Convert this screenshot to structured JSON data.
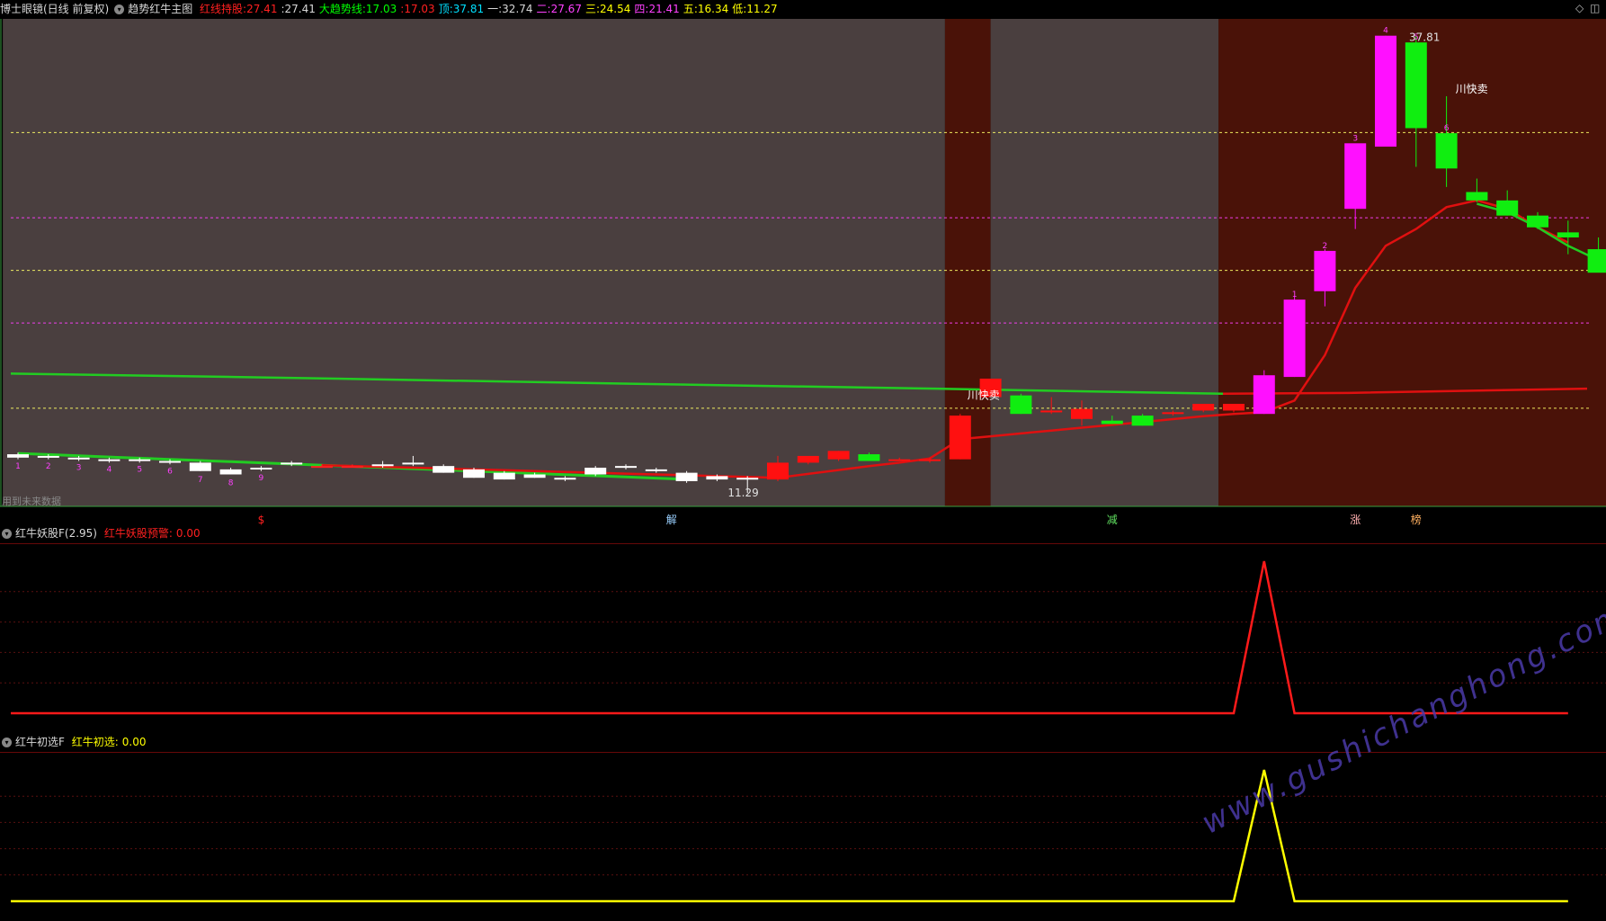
{
  "header": {
    "app_title": "博士眼镜(日线 前复权)",
    "main_indicator": "趋势红牛主图",
    "fields": [
      {
        "label": "红线持股",
        "value": "27.41",
        "color": "#ff2020"
      },
      {
        "label": "",
        "value": "27.41",
        "color": "#d8d8d8"
      },
      {
        "label": "大趋势线",
        "value": "17.03",
        "color": "#00ff00"
      },
      {
        "label": "",
        "value": "17.03",
        "color": "#ff2020"
      },
      {
        "label": "顶",
        "value": "37.81",
        "color": "#00e0ff"
      },
      {
        "label": "一",
        "value": "32.74",
        "color": "#d8d8d8"
      },
      {
        "label": "二",
        "value": "27.67",
        "color": "#ff40ff"
      },
      {
        "label": "三",
        "value": "24.54",
        "color": "#ffff00"
      },
      {
        "label": "四",
        "value": "21.41",
        "color": "#ff40ff"
      },
      {
        "label": "五",
        "value": "16.34",
        "color": "#ffff00"
      },
      {
        "label": "低",
        "value": "11.27",
        "color": "#ffff00"
      }
    ],
    "window_controls": [
      "◇",
      "◫"
    ]
  },
  "chart_data": [
    {
      "type": "candlestick",
      "title": "趋势红牛主图",
      "ylim": [
        10.5,
        39.5
      ],
      "x": [
        1,
        2,
        3,
        4,
        5,
        6,
        7,
        8,
        9,
        10,
        11,
        12,
        13,
        14,
        15,
        16,
        17,
        18,
        19,
        20,
        21,
        22,
        23,
        24,
        25,
        26,
        27,
        28,
        29,
        30,
        31,
        32,
        33,
        34,
        35,
        36,
        37,
        38,
        39,
        40,
        41,
        42,
        43,
        44,
        45,
        46,
        47,
        48,
        49,
        50,
        51,
        52
      ],
      "ohlc": [
        [
          13.6,
          13.7,
          13.3,
          13.4
        ],
        [
          13.5,
          13.6,
          13.3,
          13.4
        ],
        [
          13.4,
          13.5,
          13.2,
          13.3
        ],
        [
          13.3,
          13.4,
          13.1,
          13.2
        ],
        [
          13.3,
          13.4,
          13.1,
          13.2
        ],
        [
          13.2,
          13.3,
          13.0,
          13.1
        ],
        [
          13.1,
          13.2,
          12.6,
          12.6
        ],
        [
          12.7,
          12.8,
          12.4,
          12.4
        ],
        [
          12.8,
          12.9,
          12.6,
          12.7
        ],
        [
          13.1,
          13.2,
          12.9,
          13.0
        ],
        [
          12.9,
          13.0,
          12.8,
          12.9
        ],
        [
          12.9,
          13.0,
          12.8,
          12.9
        ],
        [
          13.0,
          13.2,
          12.8,
          12.9
        ],
        [
          13.1,
          13.5,
          12.9,
          13.0
        ],
        [
          12.9,
          13.0,
          12.5,
          12.5
        ],
        [
          12.7,
          12.8,
          12.2,
          12.2
        ],
        [
          12.5,
          12.6,
          12.1,
          12.1
        ],
        [
          12.4,
          12.5,
          12.2,
          12.2
        ],
        [
          12.2,
          12.3,
          12.0,
          12.1
        ],
        [
          12.8,
          12.9,
          12.3,
          12.4
        ],
        [
          12.9,
          13.0,
          12.7,
          12.8
        ],
        [
          12.7,
          12.8,
          12.5,
          12.6
        ],
        [
          12.5,
          12.6,
          11.9,
          12.0
        ],
        [
          12.3,
          12.4,
          12.0,
          12.1
        ],
        [
          12.2,
          12.3,
          11.3,
          12.1
        ],
        [
          12.1,
          13.5,
          12.0,
          13.1
        ],
        [
          13.1,
          13.5,
          13.0,
          13.5
        ],
        [
          13.3,
          13.8,
          13.2,
          13.8
        ],
        [
          13.6,
          13.7,
          13.2,
          13.2
        ],
        [
          13.2,
          13.4,
          13.2,
          13.3
        ],
        [
          13.3,
          13.4,
          13.1,
          13.3
        ],
        [
          13.3,
          16.0,
          13.3,
          15.9
        ],
        [
          17.0,
          17.1,
          17.0,
          18.1
        ],
        [
          17.1,
          17.2,
          16.0,
          16.0
        ],
        [
          16.2,
          17.0,
          16.0,
          16.2
        ],
        [
          15.7,
          16.8,
          15.3,
          16.3
        ],
        [
          15.6,
          15.9,
          15.4,
          15.4
        ],
        [
          15.9,
          16.0,
          15.3,
          15.3
        ],
        [
          16.0,
          16.2,
          15.9,
          16.1
        ],
        [
          16.2,
          16.6,
          16.1,
          16.6
        ],
        [
          16.2,
          16.5,
          16.1,
          16.6
        ],
        [
          16.0,
          18.6,
          16.0,
          18.3
        ],
        [
          18.2,
          23.0,
          18.2,
          22.8
        ],
        [
          23.3,
          25.8,
          22.4,
          25.7
        ],
        [
          28.2,
          28.8,
          27.0,
          32.1
        ],
        [
          31.9,
          38.5,
          31.9,
          38.5
        ],
        [
          38.1,
          38.5,
          30.7,
          33.0
        ],
        [
          32.7,
          34.9,
          29.5,
          30.6
        ],
        [
          29.2,
          30.0,
          28.6,
          28.7
        ],
        [
          28.7,
          29.3,
          27.8,
          27.8
        ],
        [
          27.8,
          28.0,
          27.0,
          27.1
        ],
        [
          26.8,
          27.5,
          25.5,
          26.5
        ],
        [
          25.8,
          26.5,
          24.6,
          24.4
        ],
        [
          24.4,
          24.6,
          24.0,
          24.4
        ]
      ],
      "hline_levels": [
        32.74,
        27.67,
        24.54,
        21.41,
        16.34
      ],
      "annotations": [
        "37.81",
        "11.29",
        "川快卖",
        "川快卖"
      ],
      "bottom_labels": [
        "$",
        "解",
        "减",
        "涨",
        "榜"
      ],
      "small_labels": [
        "1",
        "2",
        "3",
        "4",
        "5",
        "6",
        "7",
        "8",
        "9",
        "1",
        "2",
        "3",
        "4",
        "5",
        "6"
      ],
      "bottom_note": "用到未来数据"
    },
    {
      "type": "line",
      "title": "红牛妖股F(2.95)",
      "series": [
        {
          "name": "红牛妖股预警",
          "value_label": "0.00",
          "color": "#ff1a1a",
          "values": [
            0,
            0,
            0,
            0,
            0,
            0,
            0,
            0,
            0,
            0,
            0,
            0,
            0,
            0,
            0,
            0,
            0,
            0,
            0,
            0,
            0,
            0,
            0,
            0,
            0,
            0,
            0,
            0,
            0,
            0,
            0,
            0,
            0,
            0,
            0,
            0,
            0,
            0,
            0,
            0,
            0,
            1,
            0,
            0,
            0,
            0,
            0,
            0,
            0,
            0,
            0,
            0
          ]
        }
      ]
    },
    {
      "type": "line",
      "title": "红牛初选F",
      "series": [
        {
          "name": "红牛初选",
          "value_label": "0.00",
          "color": "#ffff00",
          "values": [
            0,
            0,
            0,
            0,
            0,
            0,
            0,
            0,
            0,
            0,
            0,
            0,
            0,
            0,
            0,
            0,
            0,
            0,
            0,
            0,
            0,
            0,
            0,
            0,
            0,
            0,
            0,
            0,
            0,
            0,
            0,
            0,
            0,
            0,
            0,
            0,
            0,
            0,
            0,
            0,
            0,
            1,
            0,
            0,
            0,
            0,
            0,
            0,
            0,
            0,
            0,
            0
          ]
        }
      ]
    }
  ],
  "watermark": "www.gushichanghong.com"
}
